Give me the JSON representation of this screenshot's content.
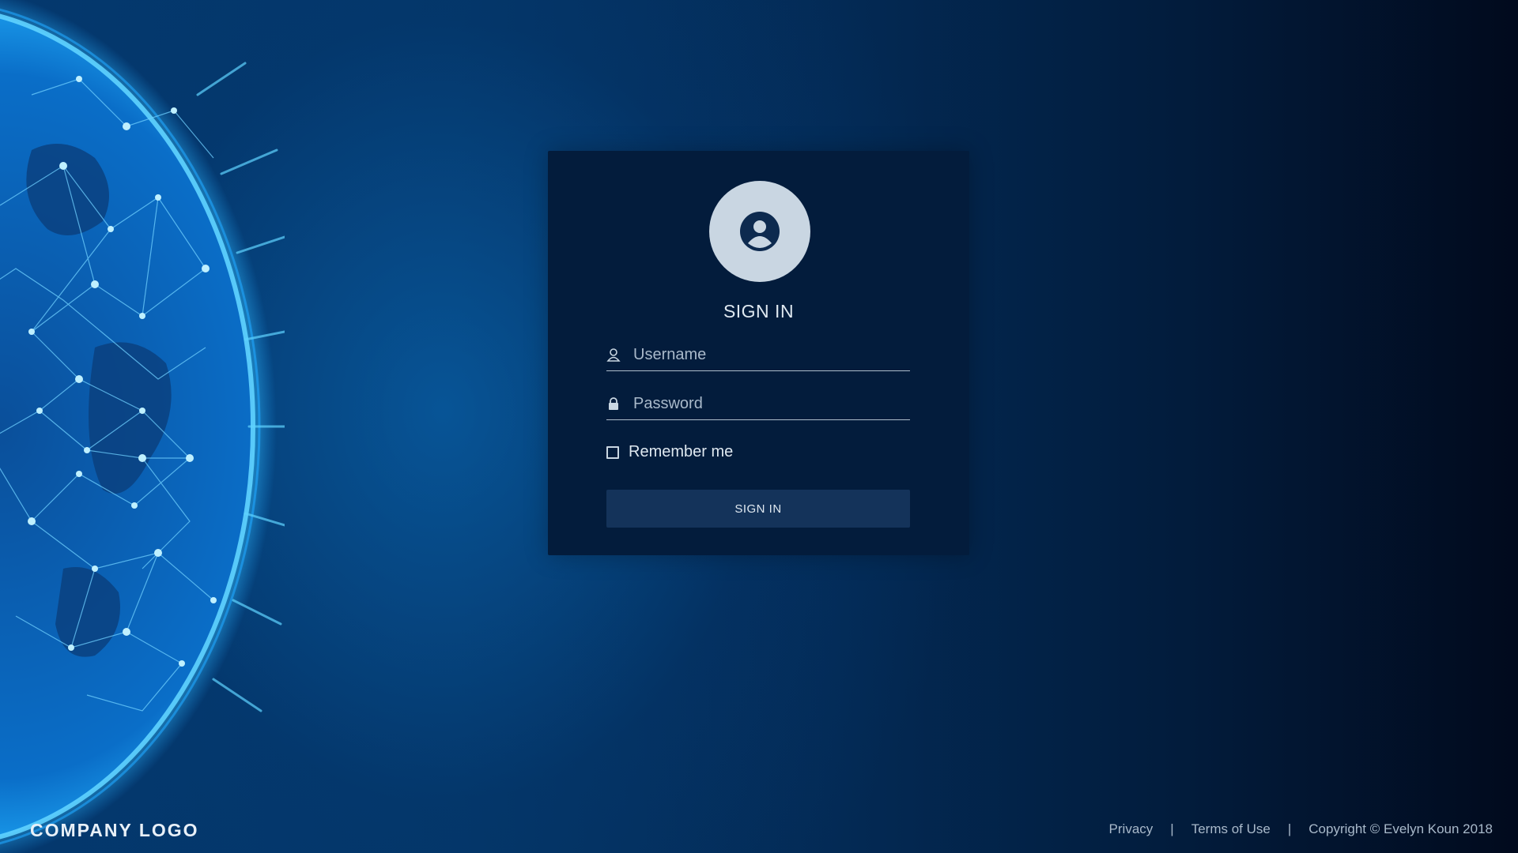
{
  "login": {
    "title": "SIGN IN",
    "username_placeholder": "Username",
    "password_placeholder": "Password",
    "remember_label": "Remember me",
    "submit_label": "SIGN IN"
  },
  "branding": {
    "logo_text": "COMPANY LOGO"
  },
  "footer": {
    "privacy": "Privacy",
    "separator": "|",
    "terms": "Terms of Use",
    "copyright": "Copyright  © Evelyn Koun 2018"
  },
  "icons": {
    "avatar": "user-circle-icon",
    "username": "user-icon",
    "password": "lock-icon"
  },
  "colors": {
    "background_start": "#04386e",
    "background_end": "#010a1d",
    "card_bg": "#031c3c",
    "button_bg": "#14335a",
    "avatar_bg": "#c9d6e2",
    "text": "#dfe8f0",
    "muted_text": "#a9b9ca",
    "globe_glow": "#1fa6ff"
  }
}
